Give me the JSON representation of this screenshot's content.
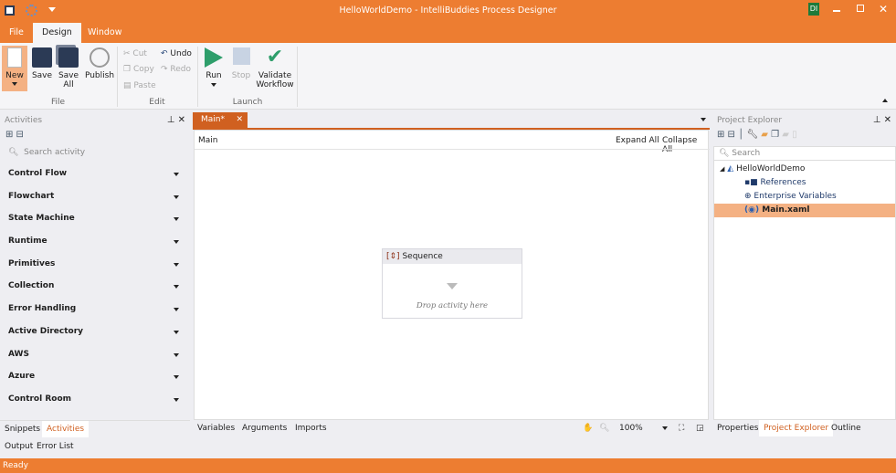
{
  "titlebar": {
    "title": "HelloWorldDemo - IntelliBuddies Process Designer",
    "user_badge": "DI",
    "icons": [
      "save-icon",
      "settings-gear-icon",
      "quick-access-dropdown-icon"
    ]
  },
  "menu_tabs": [
    {
      "label": "File"
    },
    {
      "label": "Design",
      "active": true
    },
    {
      "label": "Window"
    }
  ],
  "ribbon": {
    "file": {
      "group": "File",
      "new": "New",
      "save": "Save",
      "save_all": "Save All",
      "publish": "Publish"
    },
    "edit": {
      "group": "Edit",
      "cut": "Cut",
      "copy": "Copy",
      "paste": "Paste",
      "undo": "Undo",
      "redo": "Redo"
    },
    "launch": {
      "group": "Launch",
      "run": "Run",
      "stop": "Stop",
      "validate": "Validate Workflow"
    }
  },
  "activities": {
    "title": "Activities",
    "search_placeholder": "Search activity",
    "categories": [
      "Control Flow",
      "Flowchart",
      "State Machine",
      "Runtime",
      "Primitives",
      "Collection",
      "Error Handling",
      "Active Directory",
      "AWS",
      "Azure",
      "Control Room"
    ],
    "tabs": [
      {
        "label": "Snippets"
      },
      {
        "label": "Activities",
        "active": true
      }
    ]
  },
  "designer": {
    "tab": "Main*",
    "breadcrumb": "Main",
    "expand_all": "Expand All",
    "collapse_all": "Collapse All",
    "sequence": {
      "title": "Sequence",
      "placeholder": "Drop activity here"
    },
    "bottom_tabs": [
      "Variables",
      "Arguments",
      "Imports"
    ],
    "zoom": "100%"
  },
  "project_explorer": {
    "title": "Project Explorer",
    "search_placeholder": "Search",
    "tree": [
      {
        "label": "HelloWorldDemo"
      },
      {
        "label": "References"
      },
      {
        "label": "Enterprise Variables"
      },
      {
        "label": "Main.xaml",
        "selected": true
      }
    ],
    "tabs": [
      {
        "label": "Properties"
      },
      {
        "label": "Project Explorer",
        "active": true
      },
      {
        "label": "Outline"
      }
    ]
  },
  "output_tabs": [
    "Output",
    "Error List"
  ],
  "status": "Ready",
  "colors": {
    "accent": "#ED7D31",
    "selection": "#F4B183",
    "run": "#2E9E6B"
  }
}
